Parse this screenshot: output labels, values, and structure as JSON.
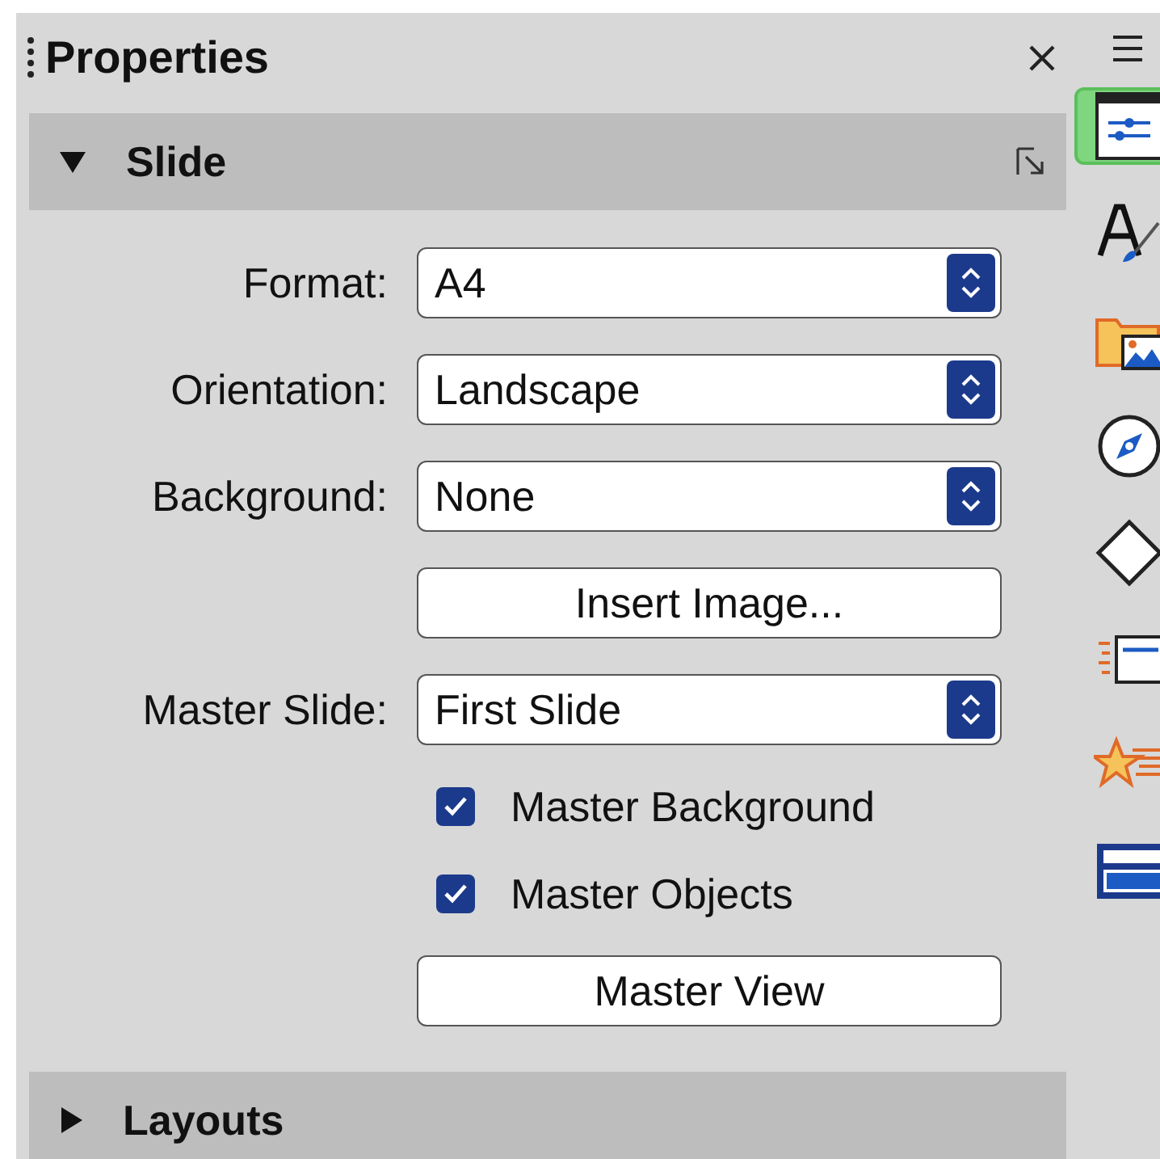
{
  "panel": {
    "title": "Properties"
  },
  "sections": [
    {
      "title": "Slide",
      "expanded": true,
      "controls": [
        {
          "kind": "dropdown",
          "label": "Format:",
          "value": "A4"
        },
        {
          "kind": "dropdown",
          "label": "Orientation:",
          "value": "Landscape"
        },
        {
          "kind": "dropdown",
          "label": "Background:",
          "value": "None"
        },
        {
          "kind": "button",
          "label": "Insert Image..."
        },
        {
          "kind": "dropdown",
          "label": "Master Slide:",
          "value": "First Slide"
        },
        {
          "kind": "checkbox",
          "label": "Master Background",
          "checked": true
        },
        {
          "kind": "checkbox",
          "label": "Master Objects",
          "checked": true
        },
        {
          "kind": "button",
          "label": "Master View"
        }
      ]
    },
    {
      "title": "Layouts",
      "expanded": false
    }
  ],
  "tabbar": {
    "items": [
      {
        "kind": "properties",
        "selected": true
      },
      {
        "kind": "styles",
        "selected": false
      },
      {
        "kind": "gallery",
        "selected": false
      },
      {
        "kind": "navigator",
        "selected": false
      },
      {
        "kind": "shapes",
        "selected": false
      },
      {
        "kind": "animation",
        "selected": false
      },
      {
        "kind": "transition",
        "selected": false
      },
      {
        "kind": "master",
        "selected": false
      }
    ]
  }
}
